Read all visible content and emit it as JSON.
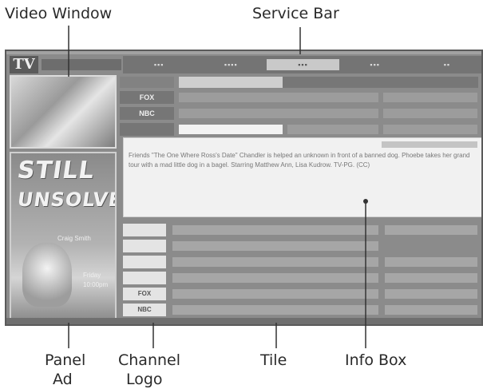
{
  "labels": {
    "video_window": "Video Window",
    "service_bar": "Service Bar",
    "panel_ad_line1": "Panel",
    "panel_ad_line2": "Ad",
    "channel_logo_line1": "Channel",
    "channel_logo_line2": "Logo",
    "tile": "Tile",
    "info_box": "Info Box"
  },
  "screen": {
    "tv_logo": "TV",
    "panel_ad_text1": "STILL",
    "panel_ad_text2": "UNSOLVED",
    "panel_ad_name": "Craig Smith",
    "panel_ad_rotate": "Friday",
    "panel_ad_time": "10:00pm",
    "row_logos": [
      "",
      "FOX",
      "NBC"
    ],
    "lower_logos": [
      "",
      "",
      "",
      "",
      "FOX",
      "NBC"
    ],
    "info_text": "Friends \"The One Where Ross's Date\" Chandler is helped an unknown in front of a banned dog. Phoebe takes her grand tour with a mad little dog in a bagel. Starring Matthew Ann, Lisa Kudrow. TV-PG. (CC)"
  }
}
